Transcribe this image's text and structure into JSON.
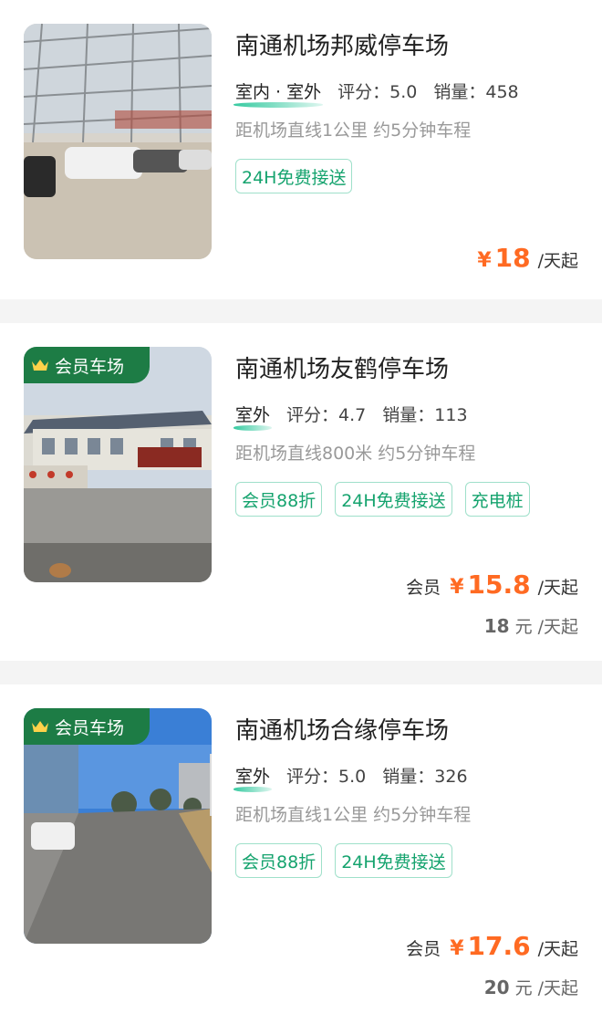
{
  "lots": [
    {
      "name": "南通机场邦威停车场",
      "type": "室内 · 室外",
      "rating_label": "评分：",
      "rating": "5.0",
      "sales_label": "销量：",
      "sales": "458",
      "distance": "距机场直线1公里 约5分钟车程",
      "tags": [
        "24H免费接送"
      ],
      "price_currency": "¥",
      "price": "18",
      "price_unit": "/天起"
    },
    {
      "name": "南通机场友鹤停车场",
      "badge": "会员车场",
      "type": "室外",
      "rating_label": "评分：",
      "rating": "4.7",
      "sales_label": "销量：",
      "sales": "113",
      "distance": "距机场直线800米 约5分钟车程",
      "tags": [
        "会员88折",
        "24H免费接送",
        "充电桩"
      ],
      "member_label": "会员",
      "price_currency": "¥",
      "price": "15.8",
      "price_unit": "/天起",
      "original_price": "18",
      "original_currency": "元",
      "original_unit": "/天起"
    },
    {
      "name": "南通机场合缘停车场",
      "badge": "会员车场",
      "type": "室外",
      "rating_label": "评分：",
      "rating": "5.0",
      "sales_label": "销量：",
      "sales": "326",
      "distance": "距机场直线1公里 约5分钟车程",
      "tags": [
        "会员88折",
        "24H免费接送"
      ],
      "member_label": "会员",
      "price_currency": "¥",
      "price": "17.6",
      "price_unit": "/天起",
      "original_price": "20",
      "original_currency": "元",
      "original_unit": "/天起"
    }
  ],
  "colors": {
    "accent": "#15a36e",
    "price": "#ff6a22",
    "badge": "#1d7c45"
  },
  "icons": {
    "badge": "crown-icon"
  }
}
